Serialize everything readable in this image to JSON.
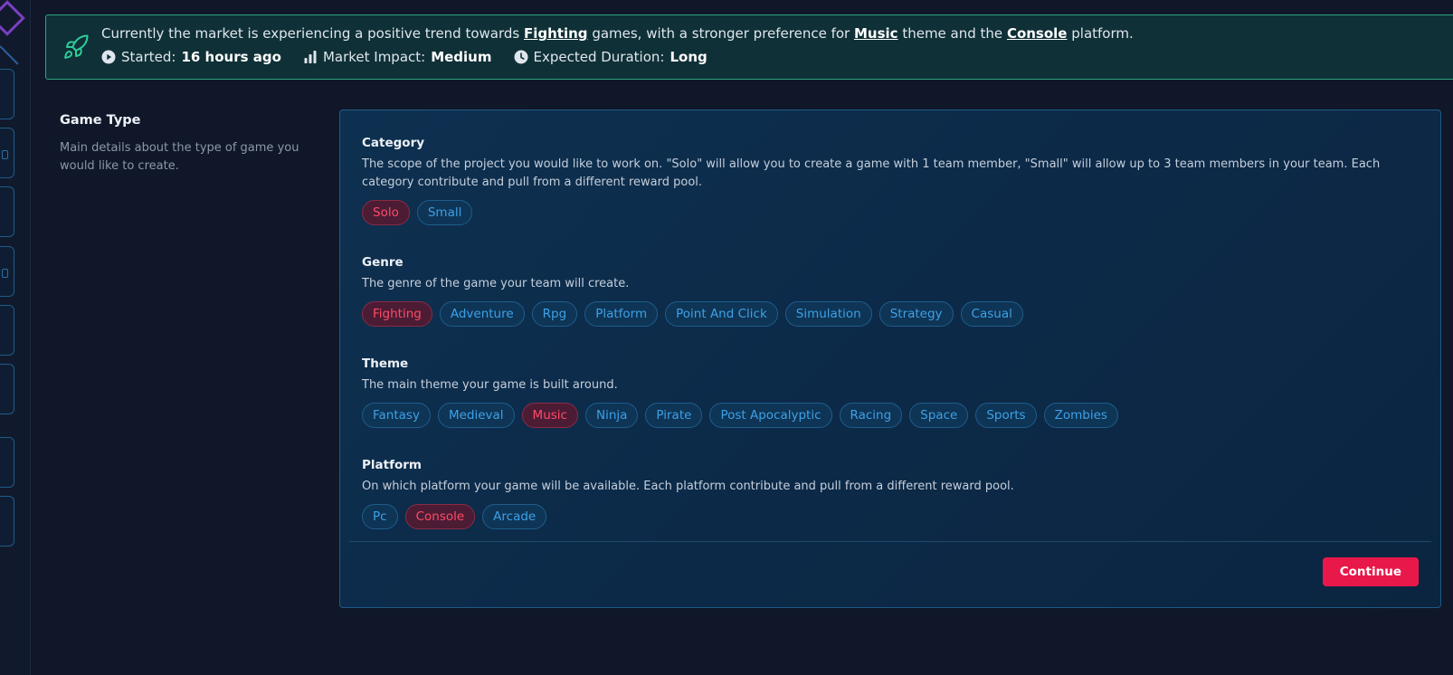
{
  "banner": {
    "text_before": "Currently the market is experiencing a positive trend towards ",
    "genre": "Fighting",
    "text_mid1": " games, with a stronger preference for ",
    "theme": "Music",
    "text_mid2": " theme and the ",
    "platform": "Console",
    "text_after": " platform.",
    "started_label": "Started:",
    "started_value": "16 hours ago",
    "impact_label": "Market Impact:",
    "impact_value": "Medium",
    "duration_label": "Expected Duration:",
    "duration_value": "Long"
  },
  "sidebar": {
    "title": "Game Type",
    "description": "Main details about the type of game you would like to create."
  },
  "sections": [
    {
      "title": "Category",
      "description": "The scope of the project you would like to work on. \"Solo\" will allow you to create a game with 1 team member, \"Small\" will allow up to 3 team members in your team. Each category contribute and pull from a different reward pool.",
      "options": [
        "Solo",
        "Small"
      ],
      "selected": "Solo"
    },
    {
      "title": "Genre",
      "description": "The genre of the game your team will create.",
      "options": [
        "Fighting",
        "Adventure",
        "Rpg",
        "Platform",
        "Point And Click",
        "Simulation",
        "Strategy",
        "Casual"
      ],
      "selected": "Fighting"
    },
    {
      "title": "Theme",
      "description": "The main theme your game is built around.",
      "options": [
        "Fantasy",
        "Medieval",
        "Music",
        "Ninja",
        "Pirate",
        "Post Apocalyptic",
        "Racing",
        "Space",
        "Sports",
        "Zombies"
      ],
      "selected": "Music"
    },
    {
      "title": "Platform",
      "description": "On which platform your game will be available. Each platform contribute and pull from a different reward pool.",
      "options": [
        "Pc",
        "Console",
        "Arcade"
      ],
      "selected": "Console"
    }
  ],
  "actions": {
    "continue_label": "Continue"
  },
  "colors": {
    "accent": "#e8184a",
    "selected_tag_text": "#ff4a67",
    "tag_text": "#3ea0e6",
    "banner_border": "#2ea382"
  },
  "icons": {
    "banner": "rocket-icon",
    "started": "play-circle-icon",
    "impact": "bar-chart-icon",
    "duration": "clock-icon"
  }
}
